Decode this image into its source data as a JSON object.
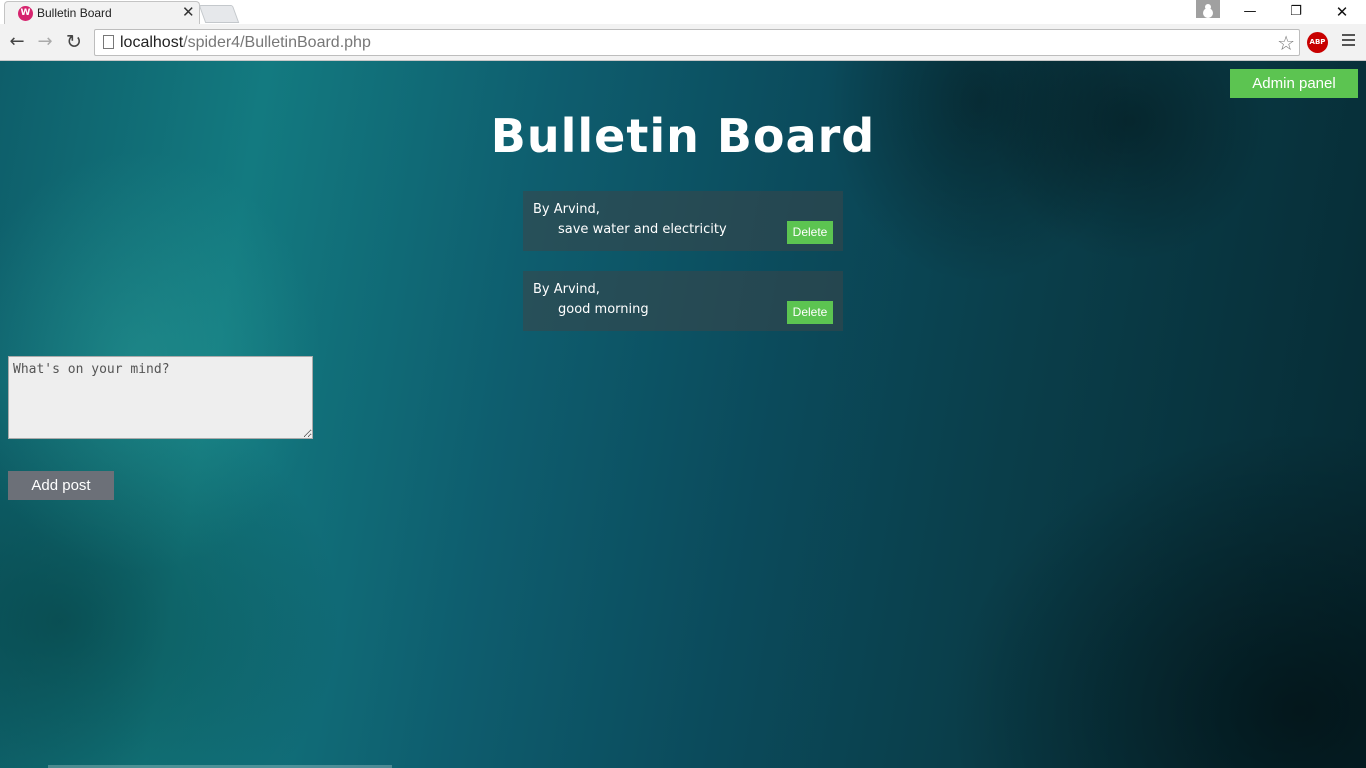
{
  "browser": {
    "tab_title": "Bulletin Board",
    "favicon_label": "W",
    "url_host": "localhost",
    "url_path": "/spider4/BulletinBoard.php",
    "adblock_label": "ABP"
  },
  "page": {
    "admin_button": "Admin panel",
    "title": "Bulletin Board",
    "posts": [
      {
        "author": "By Arvind,",
        "text": "save water and electricity",
        "delete_label": "Delete"
      },
      {
        "author": "By Arvind,",
        "text": "good morning",
        "delete_label": "Delete"
      }
    ],
    "composer": {
      "placeholder": "What's on your mind?",
      "submit_label": "Add post"
    }
  },
  "colors": {
    "accent_green": "#5cc451",
    "button_gray": "#6c7078",
    "background_teal": "#0e5e6a"
  },
  "icons": [
    "back-arrow-icon",
    "forward-arrow-icon",
    "reload-icon",
    "page-icon",
    "star-icon",
    "adblock-icon",
    "menu-icon",
    "close-icon",
    "minimize-icon",
    "maximize-icon",
    "user-icon"
  ]
}
